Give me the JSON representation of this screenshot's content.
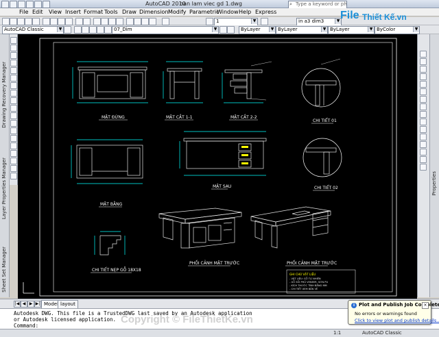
{
  "window": {
    "app_title": "AutoCAD 2010",
    "file_title": "ban lam viec gd 1.dwg"
  },
  "search": {
    "placeholder": "Type a keyword or phrase"
  },
  "menu": [
    "File",
    "Edit",
    "View",
    "Insert",
    "Format",
    "Tools",
    "Draw",
    "Dimension",
    "Modify",
    "Parametric",
    "Window",
    "Help",
    "Express"
  ],
  "toolbar": {
    "workspace": "AutoCAD Classic",
    "layer": "07_Dim",
    "scale": "1",
    "dimstyle": "in a3 dim3",
    "color": "ByLayer",
    "linetype": "ByLayer",
    "lineweight": "ByLayer",
    "plotstyle": "ByColor"
  },
  "palettes": {
    "left": [
      "Drawing Recovery Manager",
      "Layer Properties Manager",
      "Sheet Set Manager"
    ],
    "right": "Properties"
  },
  "tabs": [
    "Model",
    "layout"
  ],
  "command": {
    "line1": "Autodesk DWG.  This file is a TrustedDWG last saved by an Autodesk application",
    "line2": "or Autodesk licensed application.",
    "prompt": "Command:"
  },
  "status": {
    "workspace": "AutoCAD Classic",
    "scale": "1:1"
  },
  "notification": {
    "title": "Plot and Publish Job Complete",
    "line": "No errors or warnings found",
    "link": "Click to view plot and publish details..."
  },
  "watermark": {
    "logo_file": "File",
    "logo_rest": "Thiết Kế.vn",
    "copyright": "Copyright © FileThietKe.vn"
  },
  "drawing": {
    "labels": {
      "front": "MẶT ĐỨNG",
      "section11": "MẶT CẮT 1-1",
      "section22": "MẶT CẮT 2-2",
      "detail1": "CHI TIẾT 01",
      "back": "MẶT SAU",
      "detail2": "CHI TIẾT 02",
      "plan": "MẶT BẰNG",
      "detail_moulding": "CHI TIẾT NẸP GỖ 18X18",
      "perspective_front": "PHỐI CẢNH MẶT TRƯỚC",
      "perspective_front2": "PHỐI CẢNH MẶT TRƯỚC",
      "notes_title": "GHI CHÚ VẬT LIỆU",
      "notes": [
        "- VẬT LIỆU: GỖ TỰ NHIÊN",
        "- GỖ SỒI PHỦ VENEER, SƠN PU",
        "- KÍCH THƯỚC TÍNH BẰNG MM",
        "- CHI TIẾT XEM BẢN VẼ"
      ]
    },
    "colors": {
      "bg": "#000000",
      "frame": "#ffffff",
      "dim": "#00ffff",
      "object": "#e6e6e6",
      "accent": "#ffff00",
      "hidden": "#ff3030"
    }
  }
}
